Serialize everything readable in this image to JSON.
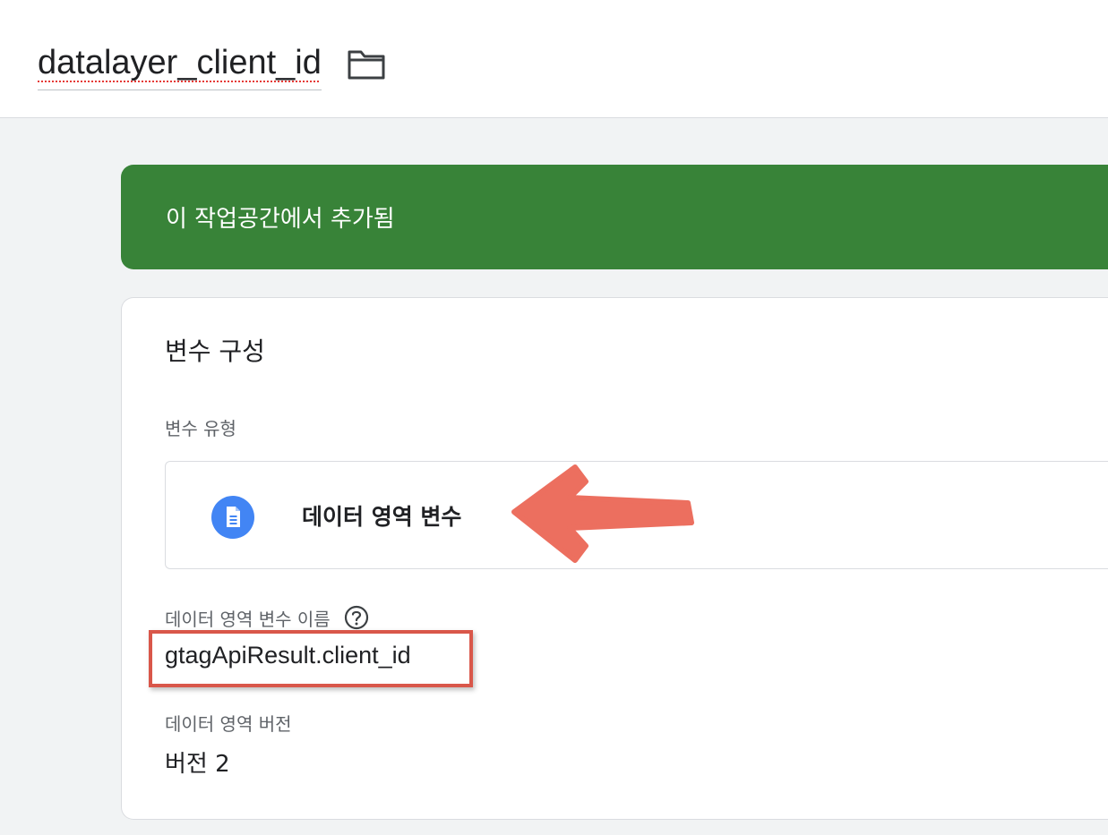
{
  "header": {
    "title": "datalayer_client_id",
    "folder_icon": "folder-outline-icon"
  },
  "banner": {
    "text": "이 작업공간에서 추가됨",
    "color": "#388338"
  },
  "card": {
    "section_title": "변수 구성",
    "type_label": "변수 유형",
    "type_name": "데이터 영역 변수",
    "type_icon": "document-icon",
    "type_icon_color": "#4285f4",
    "name_label": "데이터 영역 변수 이름",
    "help_icon": "help-circle-icon",
    "name_value": "gtagApiResult.client_id",
    "version_label": "데이터 영역 버전",
    "version_value": "버전 2"
  },
  "annotations": {
    "arrow_color": "#ec6f5f",
    "highlight_color": "#d9574a"
  }
}
